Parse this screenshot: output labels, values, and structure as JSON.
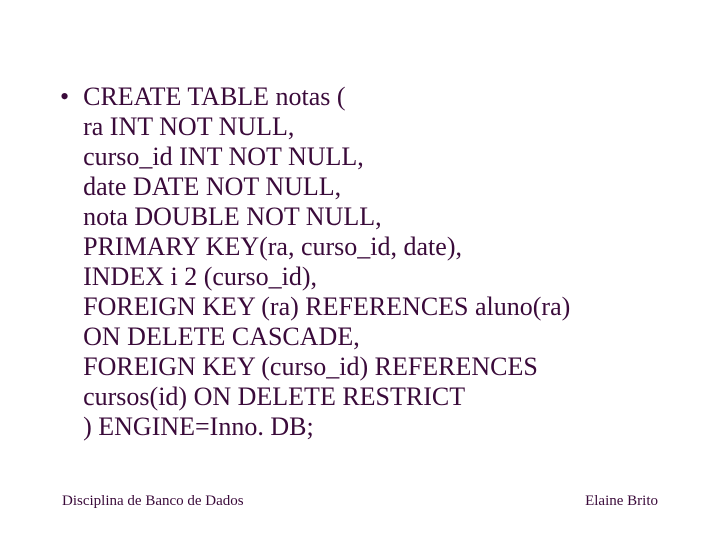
{
  "code": {
    "lines": [
      "CREATE TABLE notas (",
      "ra INT NOT NULL,",
      "curso_id INT NOT NULL,",
      "date DATE NOT NULL,",
      "nota DOUBLE NOT NULL,",
      "PRIMARY KEY(ra, curso_id, date),",
      "INDEX i 2 (curso_id),",
      "FOREIGN KEY (ra) REFERENCES aluno(ra)",
      "ON DELETE CASCADE,",
      "FOREIGN KEY (curso_id) REFERENCES",
      "cursos(id) ON DELETE RESTRICT",
      ") ENGINE=Inno. DB;"
    ]
  },
  "footer": {
    "left": "Disciplina de Banco de Dados",
    "right": "Elaine Brito"
  }
}
